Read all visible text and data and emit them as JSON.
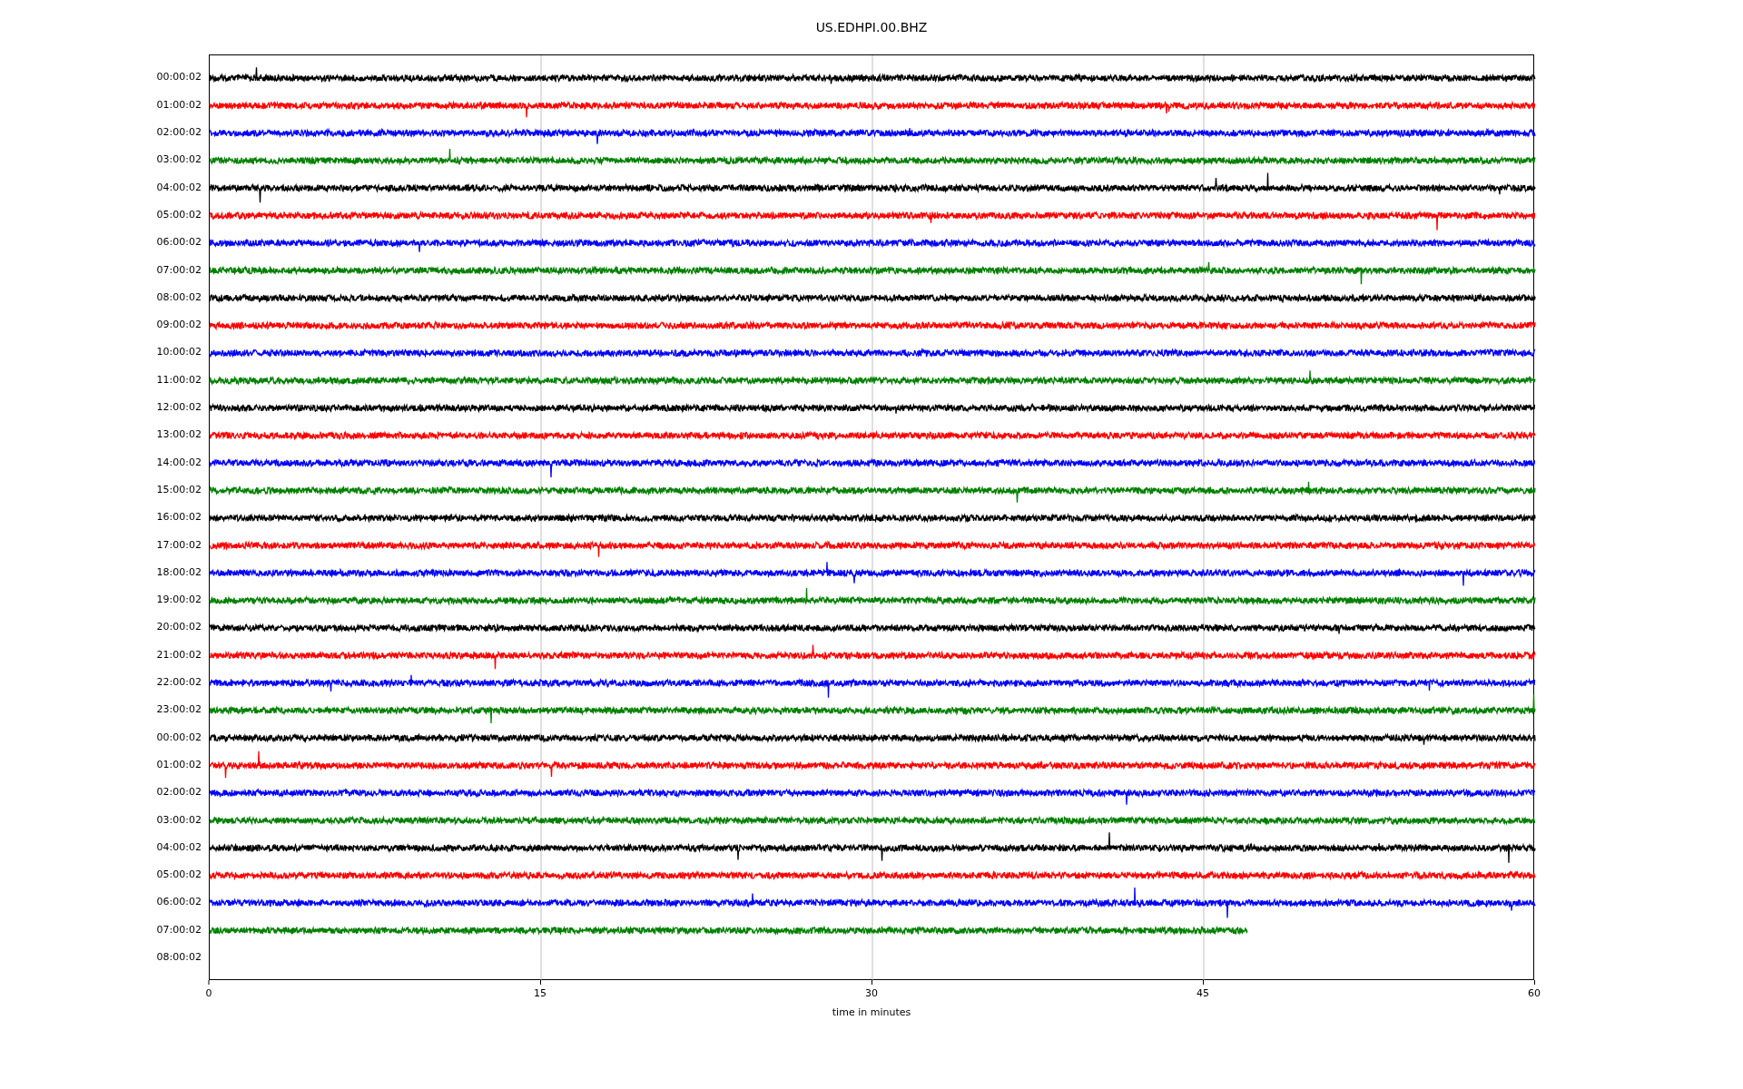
{
  "title": "US.EDHPI.00.BHZ",
  "traces": [
    {
      "label": "00:00:02",
      "color": "#000000",
      "level": 1
    },
    {
      "label": "01:00:02",
      "color": "#ff0000",
      "level": 1
    },
    {
      "label": "02:00:02",
      "color": "#0000ff",
      "level": 1
    },
    {
      "label": "03:00:02",
      "color": "#008000",
      "level": 1
    },
    {
      "label": "04:00:02",
      "color": "#000000",
      "level": 1
    },
    {
      "label": "05:00:02",
      "color": "#ff0000",
      "level": 1
    },
    {
      "label": "06:00:02",
      "color": "#0000ff",
      "level": 1
    },
    {
      "label": "07:00:02",
      "color": "#008000",
      "level": 1
    },
    {
      "label": "08:00:02",
      "color": "#000000",
      "level": 1
    },
    {
      "label": "09:00:02",
      "color": "#ff0000",
      "level": 1
    },
    {
      "label": "10:00:02",
      "color": "#0000ff",
      "level": 1
    },
    {
      "label": "11:00:02",
      "color": "#008000",
      "level": 1
    },
    {
      "label": "12:00:02",
      "color": "#000000",
      "level": 1
    },
    {
      "label": "13:00:02",
      "color": "#ff0000",
      "level": 1
    },
    {
      "label": "14:00:02",
      "color": "#0000ff",
      "level": 1
    },
    {
      "label": "15:00:02",
      "color": "#008000",
      "level": 1
    },
    {
      "label": "16:00:02",
      "color": "#000000",
      "level": 1
    },
    {
      "label": "17:00:02",
      "color": "#ff0000",
      "level": 1
    },
    {
      "label": "18:00:02",
      "color": "#0000ff",
      "level": 1
    },
    {
      "label": "19:00:02",
      "color": "#008000",
      "level": 1
    },
    {
      "label": "20:00:02",
      "color": "#000000",
      "level": 1
    },
    {
      "label": "21:00:02",
      "color": "#ff0000",
      "level": 1
    },
    {
      "label": "22:00:02",
      "color": "#0000ff",
      "level": 1
    },
    {
      "label": "23:00:02",
      "color": "#008000",
      "level": 1
    },
    {
      "label": "00:00:02",
      "color": "#000000",
      "level": 1
    },
    {
      "label": "01:00:02",
      "color": "#ff0000",
      "level": 1
    },
    {
      "label": "02:00:02",
      "color": "#0000ff",
      "level": 1
    },
    {
      "label": "03:00:02",
      "color": "#008000",
      "level": 1
    },
    {
      "label": "04:00:02",
      "color": "#000000",
      "level": 1
    },
    {
      "label": "05:00:02",
      "color": "#ff0000",
      "level": 1
    },
    {
      "label": "06:00:02",
      "color": "#0000ff",
      "level": 1
    },
    {
      "label": "07:00:02",
      "color": "#008000",
      "level": 0.783
    },
    {
      "label": "08:00:02"
    }
  ],
  "x_ticks": [
    "0",
    "15",
    "30",
    "45",
    "60"
  ],
  "xlabel": "time in minutes"
}
